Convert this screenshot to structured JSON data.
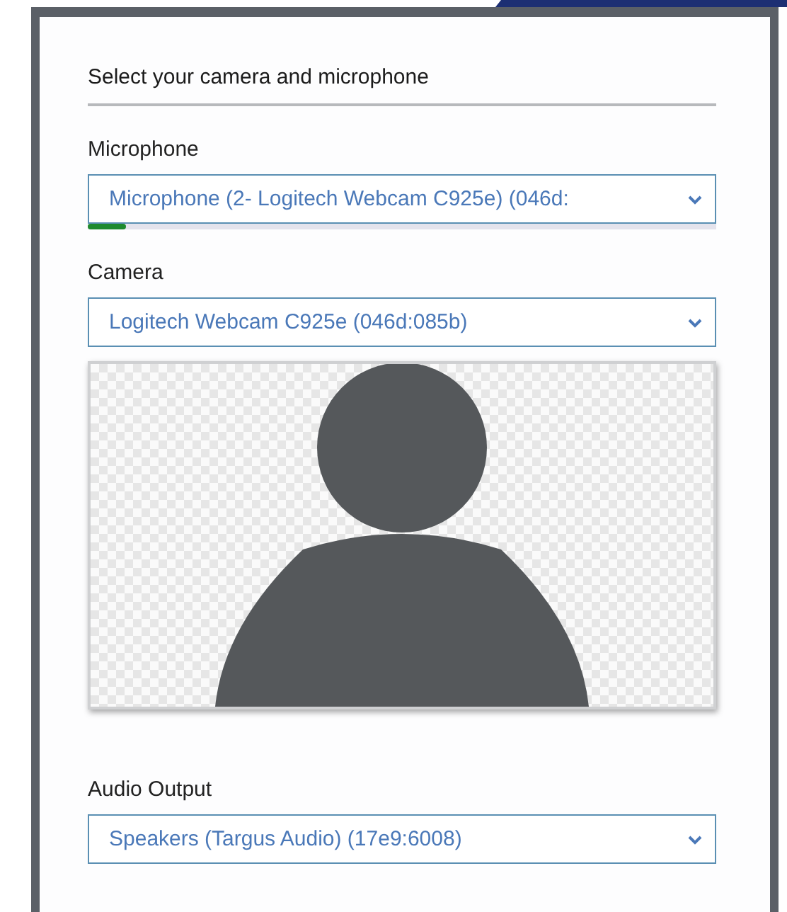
{
  "panel": {
    "title": "Select your camera and microphone"
  },
  "fields": [
    {
      "kind": "meter",
      "label": "Microphone",
      "value": "Microphone (2- Logitech Webcam C925e) (046d:",
      "level": 0.06
    },
    {
      "kind": "preview",
      "label": "Camera",
      "value": "Logitech Webcam C925e (046d:085b)"
    },
    {
      "kind": "plain",
      "label": "Audio Output",
      "value": "Speakers (Targus Audio) (17e9:6008)"
    }
  ]
}
